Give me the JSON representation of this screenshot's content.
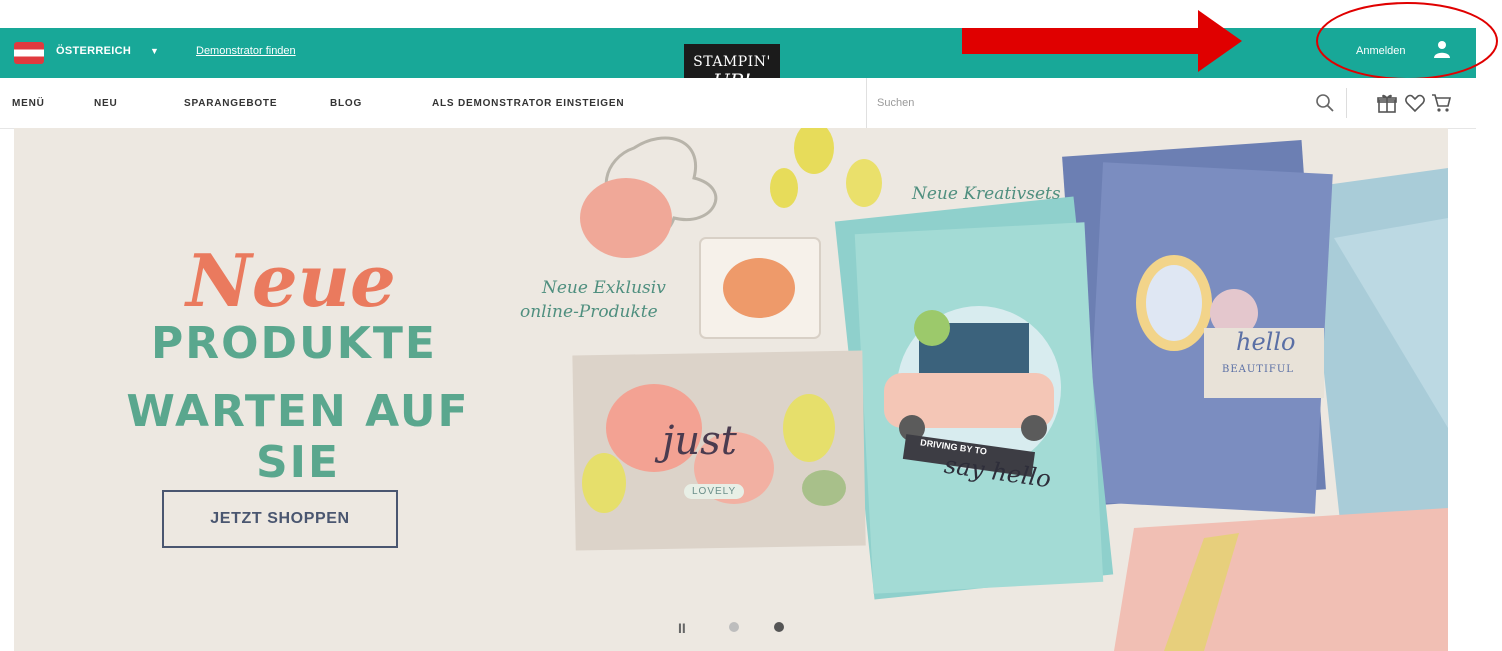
{
  "topbar": {
    "country": "ÖSTERREICH",
    "demo_link": "Demonstrator finden",
    "login": "Anmelden"
  },
  "logo": {
    "line1": "STAMPIN'",
    "line2": "UP!"
  },
  "nav": {
    "items": [
      "MENÜ",
      "NEU",
      "SPARANGEBOTE",
      "BLOG",
      "ALS DEMONSTRATOR EINSTEIGEN"
    ],
    "search_placeholder": "Suchen"
  },
  "hero": {
    "title_script": "Neue",
    "title_line1": "PRODUKTE",
    "title_line2": "WARTEN AUF SIE",
    "cta": "JETZT SHOPPEN",
    "callout_1": "Neue Exklusiv",
    "callout_2": "online-Produkte",
    "callout_3": "Neue Kreativsets",
    "card_text_1": "just",
    "card_text_2": "LOVELY",
    "card_text_3": "DRIVING BY TO",
    "card_text_4": "say hello",
    "card_text_5": "hello",
    "card_text_6": "BEAUTIFUL"
  },
  "carousel": {
    "pause_icon": "pause-icon",
    "active_index": 2,
    "slides": 2
  },
  "colors": {
    "teal": "#18a898",
    "coral": "#ea7a5e",
    "green": "#5aa78e",
    "navy": "#4a5670",
    "annotation_red": "#e00000"
  }
}
